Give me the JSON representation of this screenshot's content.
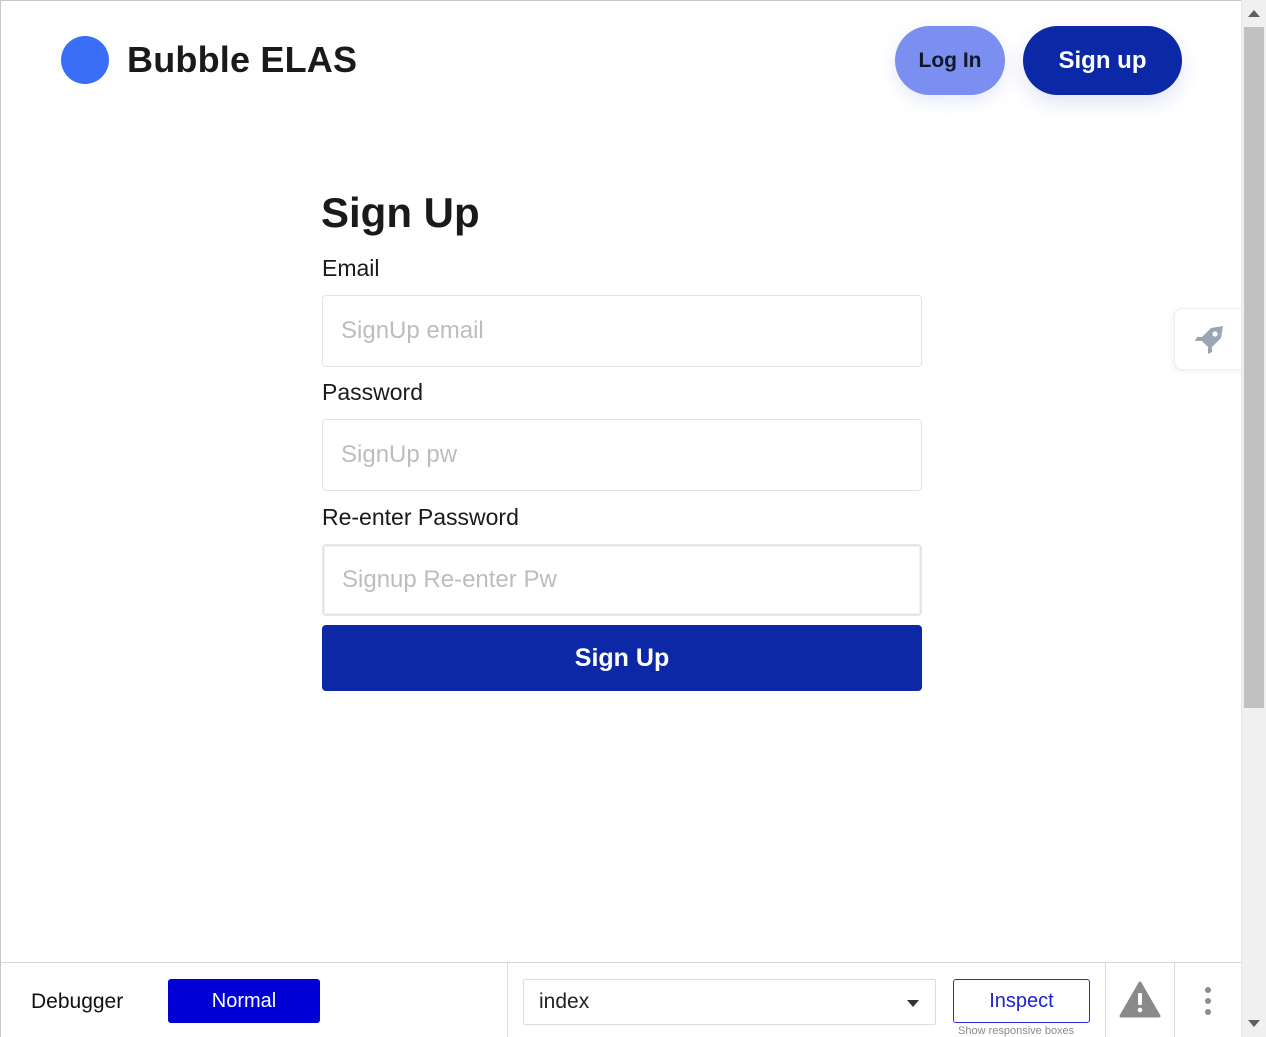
{
  "header": {
    "brand_name": "Bubble ELAS",
    "login_label": "Log In",
    "signup_label": "Sign up"
  },
  "form": {
    "title": "Sign Up",
    "email_label": "Email",
    "email_placeholder": "SignUp email",
    "password_label": "Password",
    "password_placeholder": "SignUp pw",
    "reenter_label": "Re-enter Password",
    "reenter_placeholder": "Signup Re-enter Pw",
    "submit_label": "Sign Up"
  },
  "side_tab": {
    "icon": "rocket-icon"
  },
  "debugger": {
    "label": "Debugger",
    "mode_label": "Normal",
    "page_select_value": "index",
    "inspect_label": "Inspect",
    "inspect_hint": "Show responsive boxes",
    "warning_icon": "warning-icon",
    "more_icon": "more-vertical-icon"
  },
  "colors": {
    "brand_dot": "#3b6ef7",
    "primary": "#0b28a6",
    "login_button": "#7b8ff0",
    "debugger_mode": "#0000d6"
  }
}
